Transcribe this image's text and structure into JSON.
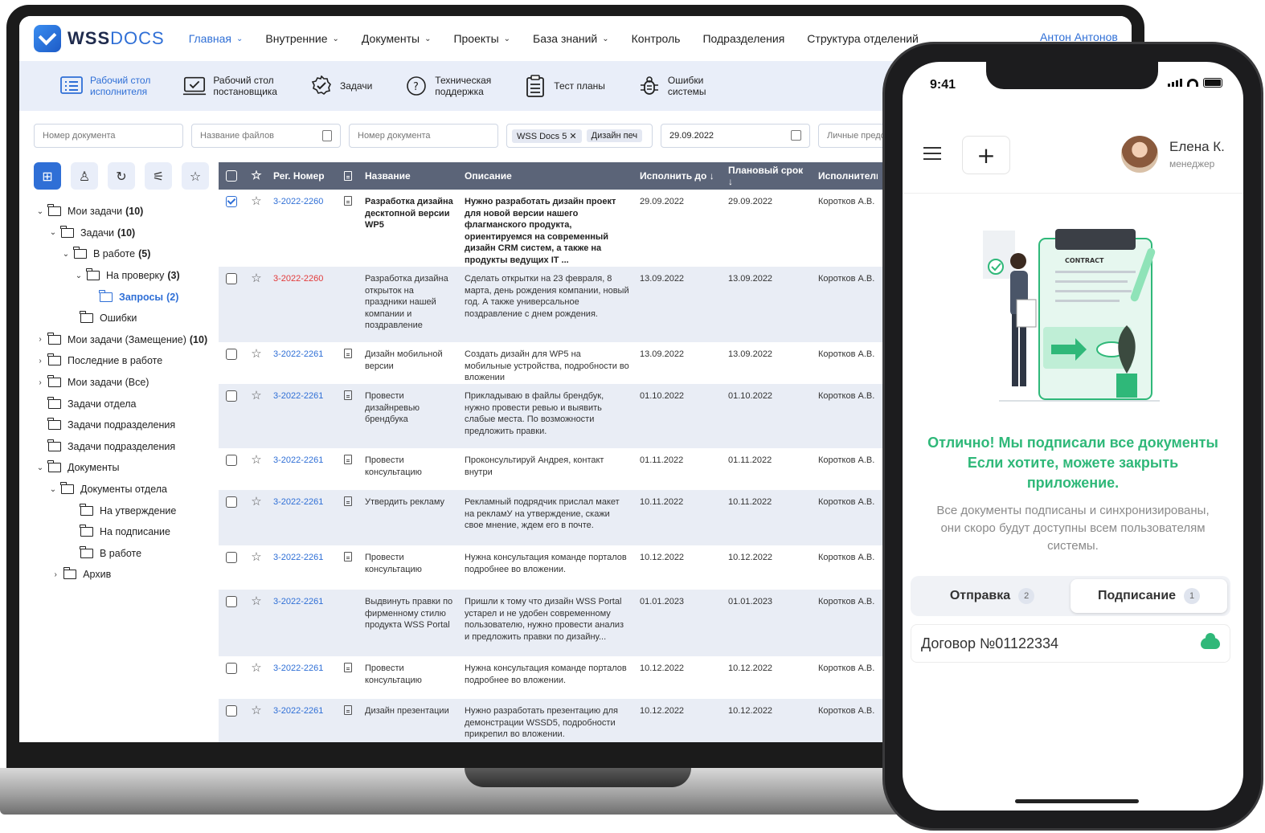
{
  "laptop": {
    "logo": {
      "bold": "WSS",
      "light": "DOCS"
    },
    "nav": [
      {
        "label": "Главная",
        "active": true,
        "dropdown": true
      },
      {
        "label": "Внутренние",
        "dropdown": true
      },
      {
        "label": "Документы",
        "dropdown": true
      },
      {
        "label": "Проекты",
        "dropdown": true
      },
      {
        "label": "База знаний",
        "dropdown": true
      },
      {
        "label": "Контроль",
        "dropdown": false
      },
      {
        "label": "Подразделения",
        "dropdown": false
      },
      {
        "label": "Структура отделений",
        "dropdown": false
      }
    ],
    "user": "Антон Антонов",
    "subnav": [
      {
        "l1": "Рабочий стол",
        "l2": "исполнителя",
        "icon": "list-icon",
        "active": true
      },
      {
        "l1": "Рабочий стол",
        "l2": "постановщика",
        "icon": "checkbox-icon"
      },
      {
        "l1": "Задачи",
        "l2": "",
        "icon": "badge-check-icon"
      },
      {
        "l1": "Техническая",
        "l2": "поддержка",
        "icon": "help-icon"
      },
      {
        "l1": "Тест планы",
        "l2": "",
        "icon": "clipboard-icon"
      },
      {
        "l1": "Ошибки",
        "l2": "системы",
        "icon": "bug-icon"
      }
    ],
    "filters": {
      "doc_number_1": "Номер документа",
      "file_name": "Название файлов",
      "doc_number_2": "Номер документа",
      "chip1": "WSS Docs 5 ✕",
      "chip2": "Дизайн печ",
      "date": "29.09.2022",
      "personal": "Личные предо"
    },
    "tree": [
      {
        "label": "Мои задачи",
        "count": "(10)",
        "level": 0,
        "arrow": "v"
      },
      {
        "label": "Задачи",
        "count": "(10)",
        "level": 1,
        "arrow": "v"
      },
      {
        "label": "В работе",
        "count": "(5)",
        "level": 2,
        "arrow": "v"
      },
      {
        "label": "На проверку",
        "count": "(3)",
        "level": 3,
        "arrow": "v"
      },
      {
        "label": "Запросы",
        "count": "(2)",
        "level": 4,
        "arrow": "",
        "selected": true
      },
      {
        "label": "Ошибки",
        "count": "",
        "level": 2.5,
        "arrow": ""
      },
      {
        "label": "Мои задачи (Замещение)",
        "count": "(10)",
        "level": 0,
        "arrow": ">"
      },
      {
        "label": "Последние в работе",
        "count": "",
        "level": 0,
        "arrow": ">"
      },
      {
        "label": "Мои задачи (Все)",
        "count": "",
        "level": 0,
        "arrow": ">"
      },
      {
        "label": "Задачи отдела",
        "count": "",
        "level": 0,
        "arrow": ""
      },
      {
        "label": "Задачи подразделения",
        "count": "",
        "level": 0,
        "arrow": ""
      },
      {
        "label": "Задачи подразделения",
        "count": "",
        "level": 0,
        "arrow": ""
      },
      {
        "label": "Документы",
        "count": "",
        "level": 0,
        "arrow": "v"
      },
      {
        "label": "Документы отдела",
        "count": "",
        "level": 1,
        "arrow": "v"
      },
      {
        "label": "На утверждение",
        "count": "",
        "level": 2.5,
        "arrow": ""
      },
      {
        "label": "На подписание",
        "count": "",
        "level": 2.5,
        "arrow": ""
      },
      {
        "label": "В работе",
        "count": "",
        "level": 2.5,
        "arrow": ""
      },
      {
        "label": "Архив",
        "count": "",
        "level": 1.2,
        "arrow": ">"
      }
    ],
    "table": {
      "headers": [
        "Рег. Номер",
        "Название",
        "Описание",
        "Исполнить до ↓",
        "Плановый срок ↓",
        "Исполнитель"
      ],
      "rows": [
        {
          "checked": true,
          "num": "3-2022-2260",
          "doc": true,
          "bold": true,
          "name": "Разработка дизайна десктопной версии WP5",
          "desc": "Нужно разработать дизайн проект для новой версии нашего флагманского продукта, ориентируемся на современный дизайн CRM систем, а также на продукты ведущих IT ...",
          "due": "29.09.2022",
          "plan": "29.09.2022",
          "exec": "Коротков А.В.",
          "h": 96
        },
        {
          "checked": false,
          "num": "3-2022-2260",
          "red": true,
          "doc": false,
          "name": "Разработка дизайна открыток на праздники нашей компании и поздравление",
          "desc": "Сделать открытки на 23 февраля, 8 марта, день рождения компании, новый год. А также универсальное поздравление с днем рождения.",
          "due": "13.09.2022",
          "plan": "13.09.2022",
          "exec": "Коротков А.В.",
          "h": 94,
          "alt": true
        },
        {
          "checked": false,
          "num": "3-2022-2261",
          "doc": true,
          "name": "Дизайн мобильной версии",
          "desc": "Создать дизайн для WP5 на мобильные устройства, подробности во вложении",
          "due": "13.09.2022",
          "plan": "13.09.2022",
          "exec": "Коротков А.В.",
          "h": 52
        },
        {
          "checked": false,
          "num": "3-2022-2261",
          "doc": true,
          "name": "Провести дизайнревью брендбука",
          "desc": "Прикладываю в файлы брендбук, нужно провести ревью и выявить слабые места. По возможности предложить правки.",
          "due": "01.10.2022",
          "plan": "01.10.2022",
          "exec": "Коротков А.В.",
          "h": 80,
          "alt": true
        },
        {
          "checked": false,
          "num": "3-2022-2261",
          "doc": true,
          "name": "Провести консультацию",
          "desc": "Проконсультируй Андрея, контакт внутри",
          "due": "01.11.2022",
          "plan": "01.11.2022",
          "exec": "Коротков А.В.",
          "h": 52
        },
        {
          "checked": false,
          "num": "3-2022-2261",
          "doc": true,
          "name": "Утвердить рекламу",
          "desc": "Рекламный подрядчик прислал макет на рекламУ на утверждение, скажи свое мнение, ждем его в почте.",
          "due": "10.11.2022",
          "plan": "10.11.2022",
          "exec": "Коротков А.В.",
          "h": 69,
          "alt": true
        },
        {
          "checked": false,
          "num": "3-2022-2261",
          "doc": true,
          "name": "Провести консультацию",
          "desc": "Нужна консультация команде порталов подробнее во вложении.",
          "due": "10.12.2022",
          "plan": "10.12.2022",
          "exec": "Коротков А.В.",
          "h": 55
        },
        {
          "checked": false,
          "num": "3-2022-2261",
          "doc": false,
          "name": "Выдвинуть правки по фирменному стилю продукта WSS Portal",
          "desc": "Пришли к тому что дизайн WSS Portal устарел и не удобен современному пользователю, нужно провести анализ и предложить правки по дизайну...",
          "due": "01.01.2023",
          "plan": "01.01.2023",
          "exec": "Коротков А.В.",
          "h": 83,
          "alt": true
        },
        {
          "checked": false,
          "num": "3-2022-2261",
          "doc": true,
          "name": "Провести консультацию",
          "desc": "Нужна консультация команде порталов подробнее во вложении.",
          "due": "10.12.2022",
          "plan": "10.12.2022",
          "exec": "Коротков А.В.",
          "h": 53
        },
        {
          "checked": false,
          "num": "3-2022-2261",
          "doc": true,
          "name": "Дизайн презентации",
          "desc": "Нужно разработать презентацию для демонстрации WSSD5, подробности прикрепил во вложении.",
          "due": "10.12.2022",
          "plan": "10.12.2022",
          "exec": "Коротков А.В.",
          "h": 60,
          "alt": true
        }
      ]
    }
  },
  "phone": {
    "time": "9:41",
    "user_name": "Елена К.",
    "user_role": "менеджер",
    "contract_label": "CONTRACT",
    "success_line1": "Отлично! Мы подписали все документы",
    "success_line2": "Если хотите, можете закрыть",
    "success_line3": "приложение.",
    "note_line1": "Все документы подписаны и синхронизированы,",
    "note_line2": "они скоро будут доступны всем пользователям",
    "note_line3": "системы.",
    "tabs": [
      {
        "label": "Отправка",
        "count": "2",
        "active": false
      },
      {
        "label": "Подписание",
        "count": "1",
        "active": true
      }
    ],
    "document": "Договор №01122334",
    "colors": {
      "success": "#2fb879",
      "accent": "#2f6fd6"
    }
  }
}
